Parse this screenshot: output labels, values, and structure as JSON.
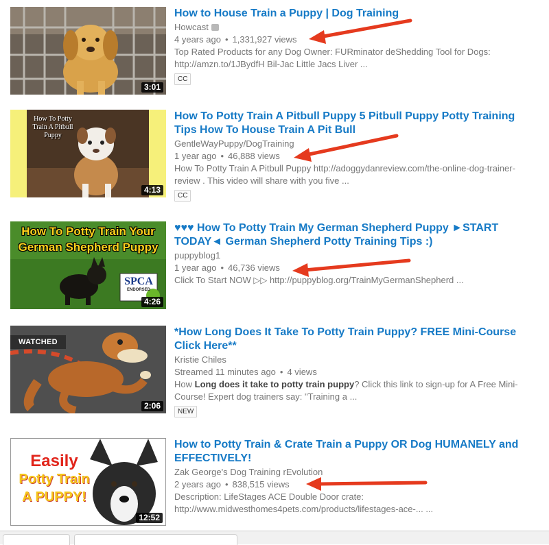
{
  "accent_color": "#167ac6",
  "arrow_color": "#e53a1e",
  "results": [
    {
      "title": "How to House Train a Puppy | Dog Training",
      "channel": "Howcast",
      "verified": true,
      "age": "4 years ago",
      "views": "1,331,927 views",
      "description": "Top Rated Products for any Dog Owner: FURminator deShedding Tool for Dogs: http://amzn.to/1JBydfH Bil-Jac Little Jacs Liver ...",
      "badge": "CC",
      "duration": "3:01"
    },
    {
      "title": "How To Potty Train A Pitbull Puppy 5 Pitbull Puppy Potty Training Tips How To House Train A Pit Bull",
      "channel": "GentleWayPuppy/DogTraining",
      "age": "1 year ago",
      "views": "46,888 views",
      "description": "How To Potty Train A Pitbull Puppy http://adoggydanreview.com/the-online-dog-trainer-review . This video will share with you five ...",
      "badge": "CC",
      "duration": "4:13",
      "thumb_text": "How To Potty Train A Pitbull Puppy"
    },
    {
      "title": "♥♥♥ How To Potty Train My German Shepherd Puppy ►START TODAY◄ German Shepherd Potty Training Tips :)",
      "channel": "puppyblog1",
      "age": "1 year ago",
      "views": "46,736 views",
      "description": "Click To Start NOW ▷▷ http://puppyblog.org/TrainMyGermanShepherd ...",
      "duration": "4:26",
      "thumb_text_1": "How To Potty Train Your",
      "thumb_text_2": "German Shepherd Puppy",
      "thumb_logo": "SPCA",
      "thumb_logo_sub": "ENDORSED"
    },
    {
      "title": "*How Long Does It Take To Potty Train Puppy? FREE Mini-Course Click Here**",
      "channel": "Kristie Chiles",
      "age": "Streamed 11 minutes ago",
      "views": "4 views",
      "description_pre": "How ",
      "description_bold": "Long does it take to potty train puppy",
      "description_post": "? Click this link to sign-up for A Free Mini-Course! Expert dog trainers say: \"Training a ...",
      "badge": "NEW",
      "duration": "2:06",
      "watched_label": "WATCHED"
    },
    {
      "title": "How to Potty Train & Crate Train a Puppy OR Dog HUMANELY and EFFECTIVELY!",
      "channel": "Zak George's Dog Training rEvolution",
      "age": "2 years ago",
      "views": "838,515 views",
      "description": "Description: LifeStages ACE Double Door crate: http://www.midwesthomes4pets.com/products/lifestages-ace-... ...",
      "duration": "12:52",
      "thumb_text_1": "Easily",
      "thumb_text_2": "Potty Train",
      "thumb_text_3": "A PUPPY!"
    }
  ]
}
